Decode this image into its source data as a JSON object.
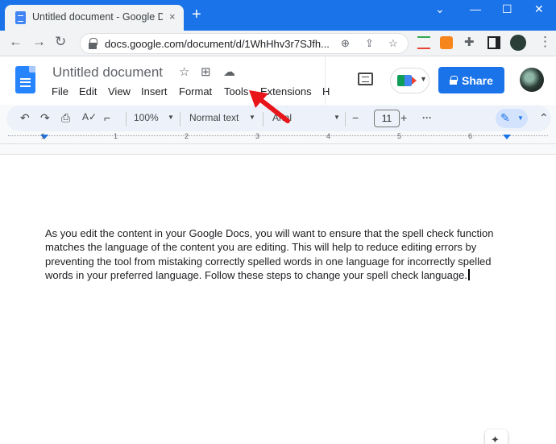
{
  "browser": {
    "tab_title": "Untitled document - Google Doc",
    "tab_close": "×",
    "new_tab": "+",
    "win_min": "⌄",
    "win_minimize": "—",
    "win_max": "☐",
    "win_close": "✕",
    "url": "docs.google.com/document/d/1WhHhv3r7SJfh..."
  },
  "docs": {
    "title": "Untitled document",
    "menu": [
      "File",
      "Edit",
      "View",
      "Insert",
      "Format",
      "Tools",
      "Extensions",
      "H"
    ],
    "share_label": "Share"
  },
  "toolbar": {
    "zoom": "100%",
    "style": "Normal text",
    "font": "Arial",
    "font_size": "11",
    "minus": "−",
    "plus": "+",
    "more": "···"
  },
  "ruler": {
    "numbers": [
      "1",
      "1",
      "2",
      "3",
      "4",
      "5",
      "6"
    ]
  },
  "document": {
    "body": "As you edit the content in your Google Docs, you will want to ensure that the spell check function matches the language of the content you are editing. This will help to reduce editing errors by preventing the tool from mistaking correctly spelled words in one language for incorrectly spelled words in your preferred language. Follow these steps to change your spell check language."
  },
  "colors": {
    "accent": "#1a73e8",
    "annotation_arrow": "#e8151b"
  }
}
